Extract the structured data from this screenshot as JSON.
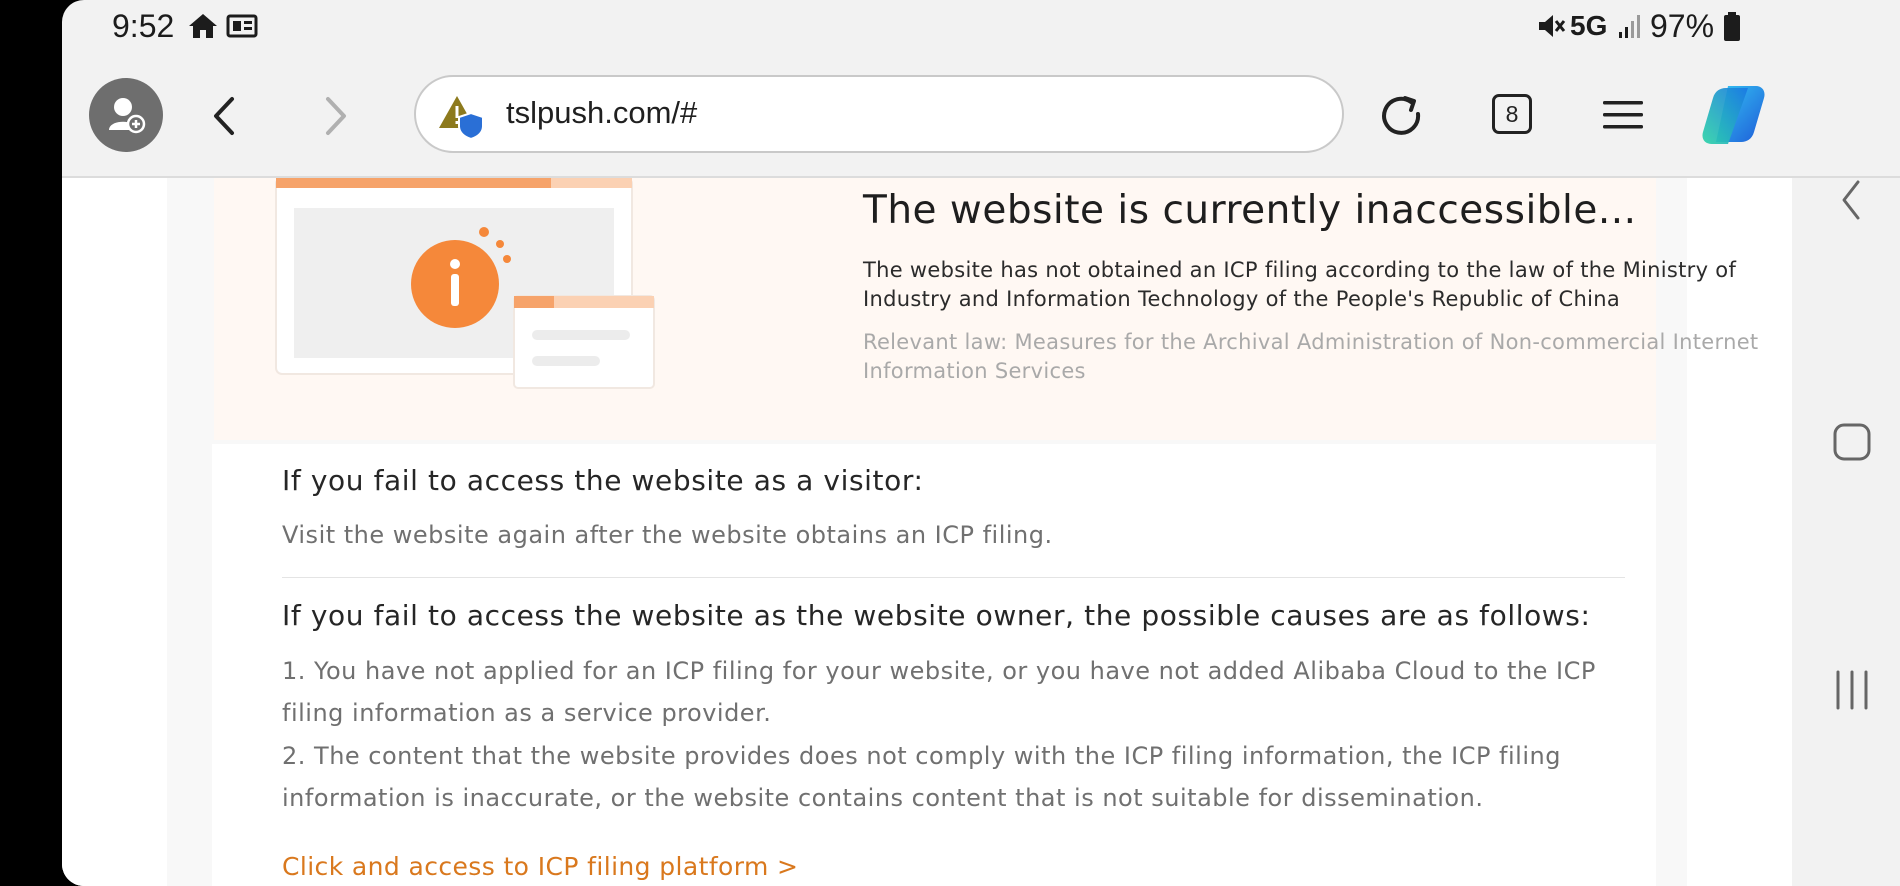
{
  "status_bar": {
    "time": "9:52",
    "network": "5G",
    "battery": "97%",
    "icons": [
      "home-icon",
      "notification-icon",
      "mute-icon",
      "signal-icon",
      "battery-icon"
    ]
  },
  "browser": {
    "url": "tslpush.com/#",
    "tab_count": "8",
    "icons": [
      "profile-icon",
      "back-icon",
      "forward-icon",
      "site-warning-icon",
      "reload-icon",
      "tabs-icon",
      "menu-icon",
      "copilot-icon"
    ]
  },
  "page": {
    "title": "The website is currently inaccessible...",
    "description": "The website has not obtained an ICP filing according to the law of the Ministry of Industry and Information Technology of the People's Republic of China",
    "law": "Relevant law: Measures for the Archival Administration of Non-commercial Internet Information Services",
    "visitor_heading": "If you fail to access the website as a visitor:",
    "visitor_text": "Visit the website again after the website obtains an ICP filing.",
    "owner_heading": "If you fail to access the website as the website owner, the possible causes are as follows:",
    "cause1_line1": "1. You have not applied for an ICP filing for your website, or you have not added Alibaba Cloud to the ICP",
    "cause1_line2": "filing information as a service provider.",
    "cause2_line1": "2. The content that the website provides does not comply with the ICP filing information, the ICP filing",
    "cause2_line2": "information is inaccurate, or the website contains content that is not suitable for dissemination.",
    "link": "Click and access to ICP filing platform >"
  },
  "colors": {
    "accent": "#d9781d",
    "hero_bg": "#fff8f3",
    "illustration_orange": "#f5883a"
  }
}
